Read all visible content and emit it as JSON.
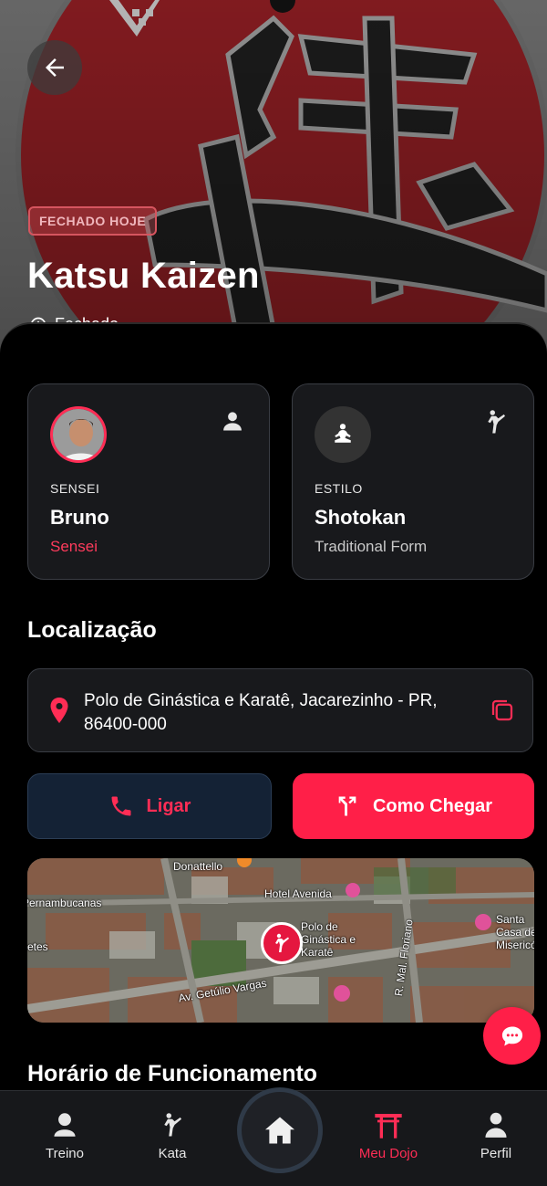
{
  "hero": {
    "status_badge": "FECHADO HOJE",
    "title": "Katsu Kaizen",
    "subtitle": "Fechado"
  },
  "cards": {
    "sensei": {
      "label": "SENSEI",
      "name": "Bruno",
      "role": "Sensei"
    },
    "style": {
      "label": "ESTILO",
      "name": "Shotokan",
      "description": "Traditional Form"
    }
  },
  "location": {
    "title": "Localização",
    "address": "Polo de Ginástica e Karatê, Jacarezinho - PR, 86400-000"
  },
  "actions": {
    "call_label": "Ligar",
    "directions_label": "Como Chegar"
  },
  "map": {
    "labels": [
      "Donattello",
      "Hotel Avenida",
      "Pernambucanas",
      "Polo de Ginástica e Karatê",
      "Av. Getúlio Vargas",
      "R. Mal. Floriano",
      "Santa Casa de Misericórdia",
      "etes"
    ]
  },
  "hours": {
    "title": "Horário de Funcionamento"
  },
  "nav": {
    "items": [
      {
        "label": "Treino",
        "icon": "person-icon"
      },
      {
        "label": "Kata",
        "icon": "karate-kick-icon"
      },
      {
        "label": "Meu Dojo",
        "icon": "torii-gate-icon",
        "active": true
      },
      {
        "label": "Perfil",
        "icon": "profile-icon"
      }
    ],
    "home_icon": "home-icon"
  },
  "colors": {
    "accent": "#ff2d55",
    "button_primary": "#ff1f48",
    "card_bg": "#18191c",
    "background": "#000000"
  }
}
